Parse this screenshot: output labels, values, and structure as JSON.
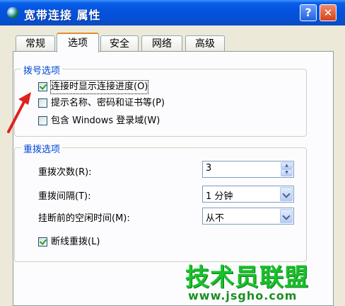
{
  "window": {
    "title": "宽带连接 属性",
    "help_label": "?",
    "close_label": "✕"
  },
  "tabs": [
    {
      "label": "常规"
    },
    {
      "label": "选项"
    },
    {
      "label": "安全"
    },
    {
      "label": "网络"
    },
    {
      "label": "高级"
    }
  ],
  "active_tab": "选项",
  "dialing_options": {
    "title": "拨号选项",
    "show_progress": {
      "label": "连接时显示连接进度(O)",
      "checked": true
    },
    "prompt_credentials": {
      "label": "提示名称、密码和证书等(P)",
      "checked": false
    },
    "include_domain": {
      "label": "包含 Windows 登录域(W)",
      "checked": false
    }
  },
  "redial_options": {
    "title": "重拨选项",
    "attempts": {
      "label": "重拨次数(R):",
      "value": "3"
    },
    "interval": {
      "label": "重拨间隔(T):",
      "value": "1 分钟"
    },
    "idle_time": {
      "label": "挂断前的空闲时间(M):",
      "value": "从不"
    },
    "redial_on_drop": {
      "label": "断线重拨(L)",
      "checked": true
    }
  },
  "watermark": {
    "main": "技术员联盟",
    "sub": "www.jsgho.com"
  },
  "colors": {
    "titlebar": "#0553de",
    "group_title": "#0046d5",
    "arrow": "#e02020",
    "watermark": "#19c12a"
  }
}
